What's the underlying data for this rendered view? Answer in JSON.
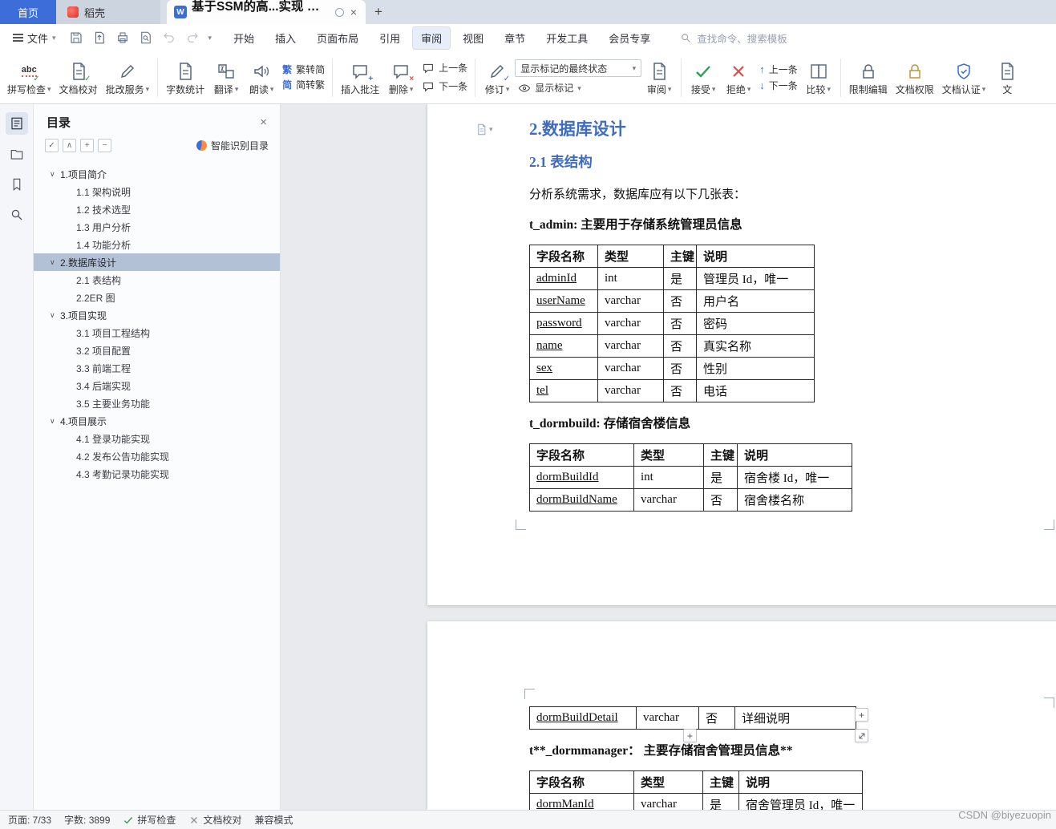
{
  "colors": {
    "accent_blue": "#3d6dd8",
    "heading_blue": "#3f6cc0",
    "toc_selected": "#b3c1d7"
  },
  "icons": {
    "spell_abc": "abc",
    "check": "✓",
    "cross": "✗",
    "close": "×",
    "plus": "+",
    "minus": "−",
    "arrow_up": "↑",
    "arrow_down": "↓",
    "chevron_down": "▾",
    "chevron_up": "∧",
    "chevron_open": "∨",
    "trad_char": "繁",
    "simp_char": "简",
    "w_badge": "W",
    "new_tab": "+"
  },
  "tabbar": {
    "home": "首页",
    "docer": "稻壳",
    "doc_title": "基于SSM的高...实现 毕业论文"
  },
  "menubar": {
    "file": "文件",
    "active": "审阅",
    "items": [
      "开始",
      "插入",
      "页面布局",
      "引用",
      "审阅",
      "视图",
      "章节",
      "开发工具",
      "会员专享"
    ],
    "search_placeholder": "查找命令、搜索模板"
  },
  "ribbon": {
    "spell_check": "拼写检查",
    "doc_proofread": "文档校对",
    "correction_service": "批改服务",
    "word_count": "字数统计",
    "translate": "翻译",
    "read_aloud": "朗读",
    "trad_to_simp": "繁转简",
    "simp_to_trad": "简转繁",
    "insert_comment": "插入批注",
    "delete_comment": "删除",
    "prev_comment": "上一条",
    "next_comment": "下一条",
    "track_changes": "修订",
    "markup_final_state": "显示标记的最终状态",
    "show_markup": "显示标记",
    "review_pane": "审阅",
    "accept": "接受",
    "reject": "拒绝",
    "prev_change": "上一条",
    "next_change": "下一条",
    "compare": "比较",
    "restrict_editing": "限制编辑",
    "doc_permission": "文档权限",
    "doc_certify": "文档认证",
    "clipped_label": "文"
  },
  "toc": {
    "title": "目录",
    "smart_recognize": "智能识别目录",
    "items": [
      {
        "label": "1.项目简介",
        "level": 1
      },
      {
        "label": "1.1 架构说明",
        "level": 2
      },
      {
        "label": "1.2 技术选型",
        "level": 2
      },
      {
        "label": "1.3 用户分析",
        "level": 2
      },
      {
        "label": "1.4 功能分析",
        "level": 2
      },
      {
        "label": "2.数据库设计",
        "level": 1,
        "selected": true
      },
      {
        "label": "2.1 表结构",
        "level": 2
      },
      {
        "label": "2.2ER 图",
        "level": 2
      },
      {
        "label": "3.项目实现",
        "level": 1
      },
      {
        "label": "3.1 项目工程结构",
        "level": 2
      },
      {
        "label": "3.2 项目配置",
        "level": 2
      },
      {
        "label": "3.3 前端工程",
        "level": 2
      },
      {
        "label": "3.4 后端实现",
        "level": 2
      },
      {
        "label": "3.5 主要业务功能",
        "level": 2
      },
      {
        "label": "4.项目展示",
        "level": 1
      },
      {
        "label": "4.1 登录功能实现",
        "level": 2
      },
      {
        "label": "4.2 发布公告功能实现",
        "level": 2
      },
      {
        "label": "4.3 考勤记录功能实现",
        "level": 2
      }
    ]
  },
  "document": {
    "page1": {
      "heading1": "2.数据库设计",
      "heading2": "2.1 表结构",
      "intro": "分析系统需求，数据库应有以下几张表：",
      "table1_title": "t_admin: 主要用于存储系统管理员信息",
      "table1": {
        "headers": [
          "字段名称",
          "类型",
          "主键",
          "说明"
        ],
        "rows": [
          [
            "adminId",
            "int",
            "是",
            "管理员 Id，唯一"
          ],
          [
            "userName",
            "varchar",
            "否",
            "用户名"
          ],
          [
            "password",
            "varchar",
            "否",
            "密码"
          ],
          [
            "name",
            "varchar",
            "否",
            "真实名称"
          ],
          [
            "sex",
            "varchar",
            "否",
            "性别"
          ],
          [
            "tel",
            "varchar",
            "否",
            "电话"
          ]
        ]
      },
      "table2_title": "t_dormbuild: 存储宿舍楼信息",
      "table2": {
        "headers": [
          "字段名称",
          "类型",
          "主键",
          "说明"
        ],
        "rows": [
          [
            "dormBuildId",
            "int",
            "是",
            "宿舍楼 Id，唯一"
          ],
          [
            "dormBuildName",
            "varchar",
            "否",
            "宿舍楼名称"
          ]
        ]
      }
    },
    "page2": {
      "orphan_table": {
        "rows": [
          [
            "dormBuildDetail",
            "varchar",
            "否",
            "详细说明"
          ]
        ]
      },
      "table3_title": "t**_dormmanager：  主要存储宿舍管理员信息**",
      "table3": {
        "headers": [
          "字段名称",
          "类型",
          "主键",
          "说明"
        ],
        "rows": [
          [
            "dormManId",
            "varchar",
            "是",
            "宿舍管理员 Id，唯一"
          ]
        ]
      }
    }
  },
  "statusbar": {
    "page": "页面: 7/33",
    "words": "字数: 3899",
    "spell": "拼写检查",
    "proofread": "文档校对",
    "compat": "兼容模式"
  },
  "watermark": "CSDN @biyezuopin"
}
